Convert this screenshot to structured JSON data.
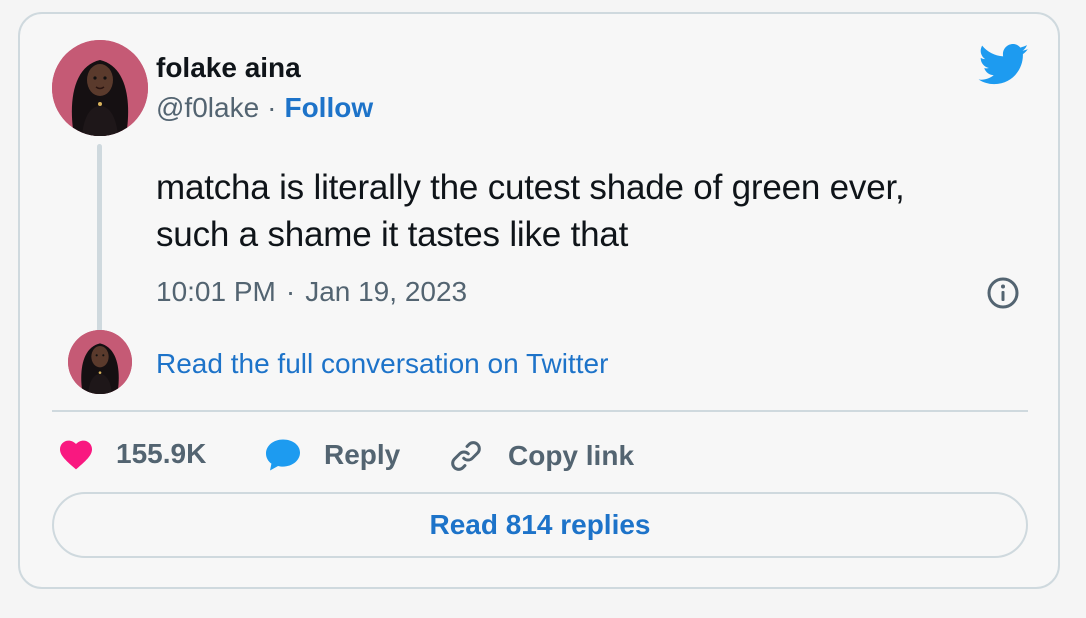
{
  "author": {
    "name": "folake aina",
    "handle": "@f0lake",
    "follow_label": "Follow",
    "separator": "·"
  },
  "tweet": {
    "text_line1": "matcha is literally the cutest shade of green ever,",
    "text_line2": "such a shame it tastes like that",
    "time": "10:01 PM",
    "date": "Jan 19, 2023",
    "separator": "·"
  },
  "conversation": {
    "link_label": "Read the full conversation on Twitter"
  },
  "actions": {
    "likes": "155.9K",
    "reply_label": "Reply",
    "copy_label": "Copy link"
  },
  "replies_button": {
    "label": "Read 814 replies"
  },
  "icons": {
    "brand": "twitter-bird-icon",
    "info": "info-icon",
    "like": "heart-icon",
    "reply": "speech-bubble-icon",
    "copy": "link-icon"
  },
  "colors": {
    "twitter_blue": "#1d9bf0",
    "link_blue": "#1d73c9",
    "heart_pink": "#f91880",
    "text": "#0f1419",
    "muted": "#536471",
    "border": "#cfd9de",
    "avatar_bg": "#c55a75"
  }
}
